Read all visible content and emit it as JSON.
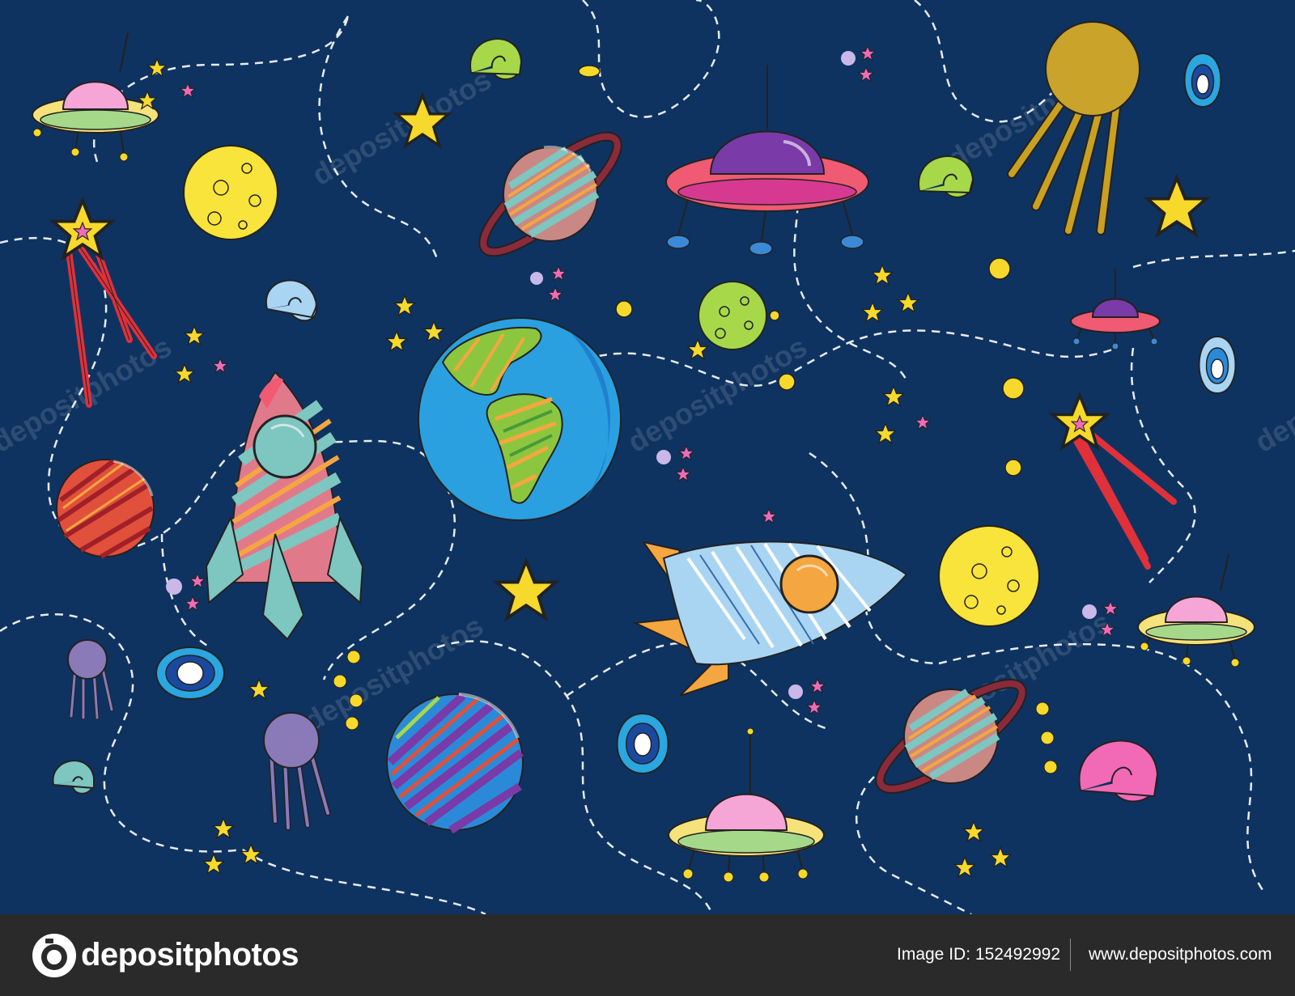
{
  "canvas": {
    "background": "#0f3360",
    "watermark_text": "depositphotos"
  },
  "footer": {
    "logo_text": "depositphotos",
    "image_id_label": "Image ID:",
    "image_id": "152492992",
    "site_url": "www.depositphotos.com",
    "background": "#2a2a2a"
  },
  "palette": {
    "yellow": "#f6d92a",
    "pink": "#f26ab6",
    "purple": "#7a3aa8",
    "red": "#e0304a",
    "teal": "#7ec6c0",
    "blue": "#2a8ad8",
    "green": "#8cc63f"
  }
}
